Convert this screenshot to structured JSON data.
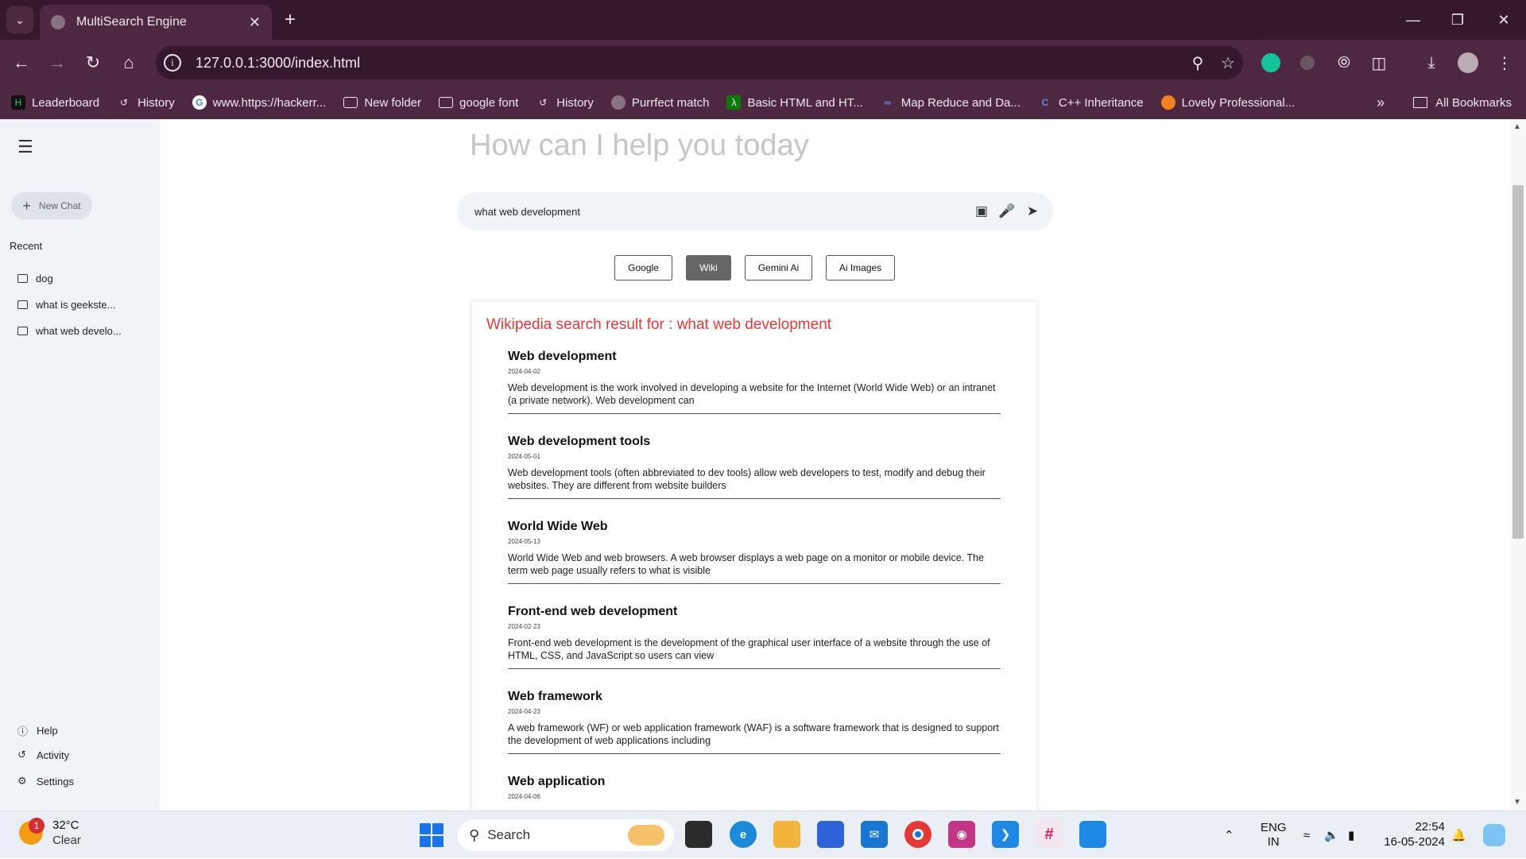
{
  "browser": {
    "tab_title": "MultiSearch Engine",
    "url": "127.0.0.1:3000/index.html",
    "bookmarks": [
      {
        "label": "Leaderboard",
        "icon": "hackerrank-icon"
      },
      {
        "label": "History",
        "icon": "history-icon"
      },
      {
        "label": "www.https://hackerr...",
        "icon": "google-icon"
      },
      {
        "label": "New folder",
        "icon": "folder-icon"
      },
      {
        "label": "google font",
        "icon": "folder-icon"
      },
      {
        "label": "History",
        "icon": "history-icon"
      },
      {
        "label": "Purrfect match",
        "icon": "globe-icon"
      },
      {
        "label": "Basic HTML and HT...",
        "icon": "freecodecamp-icon"
      },
      {
        "label": "Map Reduce and Da...",
        "icon": "meta-icon"
      },
      {
        "label": "C++ Inheritance",
        "icon": "cpp-icon"
      },
      {
        "label": "Lovely Professional...",
        "icon": "lpu-icon"
      }
    ],
    "all_bookmarks": "All Bookmarks"
  },
  "sidebar": {
    "new_chat": "New Chat",
    "recent_title": "Recent",
    "recent": [
      "dog",
      "what is geekste...",
      "what web develo..."
    ],
    "help": "Help",
    "activity": "Activity",
    "settings": "Settings"
  },
  "main": {
    "heading": "How can I help you today",
    "search_value": "what web development",
    "engines": [
      "Google",
      "Wiki",
      "Gemini Ai",
      "Ai Images"
    ],
    "active_engine": "Wiki",
    "results_heading": "Wikipedia search result for : what web development",
    "results": [
      {
        "title": "Web development",
        "date": "2024-04-02",
        "snippet": "Web development is the work involved in developing a website for the Internet (World Wide Web) or an intranet (a private network). Web development can"
      },
      {
        "title": "Web development tools",
        "date": "2024-05-01",
        "snippet": "Web development tools (often abbreviated to dev tools) allow web developers to test, modify and debug their websites. They are different from website builders"
      },
      {
        "title": "World Wide Web",
        "date": "2024-05-13",
        "snippet": "World Wide Web and web browsers. A web browser displays a web page on a monitor or mobile device. The term web page usually refers to what is visible"
      },
      {
        "title": "Front-end web development",
        "date": "2024-02-23",
        "snippet": "Front-end web development is the development of the graphical user interface of a website through the use of HTML, CSS, and JavaScript so users can view"
      },
      {
        "title": "Web framework",
        "date": "2024-04-23",
        "snippet": "A web framework (WF) or web application framework (WAF) is a software framework that is designed to support the development of web applications including"
      },
      {
        "title": "Web application",
        "date": "2024-04-06",
        "snippet": ""
      }
    ]
  },
  "taskbar": {
    "weather_badge": "1",
    "temperature": "32°C",
    "condition": "Clear",
    "search_label": "Search",
    "lang_top": "ENG",
    "lang_bottom": "IN",
    "time": "22:54",
    "date": "16-05-2024"
  },
  "colors": {
    "chrome_dark": "#35182b",
    "chrome": "#4d2840",
    "results_heading": "#e53935",
    "sidebar_bg": "#f0f4f9"
  }
}
